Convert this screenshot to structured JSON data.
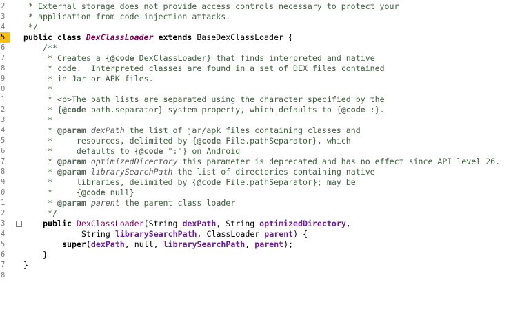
{
  "gutter": {
    "line_numbers": [
      "2",
      "3",
      "4",
      "5",
      "6",
      "7",
      "8",
      "9",
      "0",
      "1",
      "2",
      "3",
      "4",
      "5",
      "6",
      "7",
      "8",
      "9",
      "0",
      "1",
      "2",
      "3",
      "4",
      "5",
      "6",
      "7",
      "8"
    ],
    "current_line_index": 3,
    "fold_marker_glyph": "−"
  },
  "code": {
    "l0": "* External storage does not provide access controls necessary to protect your",
    "l1": "* application from code injection attacks.",
    "l2": "*/",
    "l3a": "public class ",
    "l3b": "DexClassLoader",
    "l3c": " extends ",
    "l3d": "BaseDexClassLoader {",
    "l4": "/**",
    "l5a": "* Creates a {",
    "l5b": "@code",
    "l5c": " DexClassLoader} that finds interpreted and native",
    "l6": "* code.  Interpreted classes are found in a set of DEX files contained",
    "l7": "* in Jar or APK files.",
    "l8": "*",
    "l9": "* <p>The path lists are separated using the character specified by the",
    "l10a": "* {",
    "l10b": "@code",
    "l10c": " path.separator} system property, which defaults to {",
    "l10d": "@code",
    "l10e": " :}.",
    "l11": "*",
    "l12a": "* ",
    "l12b": "@param",
    "l12c": " dexPath",
    "l12d": " the list of jar/apk files containing classes and",
    "l13a": "*     resources, delimited by {",
    "l13b": "@code",
    "l13c": " File.pathSeparator}, which",
    "l14a": "*     defaults to {",
    "l14b": "@code",
    "l14c": " \":\"} on Android",
    "l15a": "* ",
    "l15b": "@param",
    "l15c": " optimizedDirectory",
    "l15d": " this parameter is deprecated and has no effect since API level 26.",
    "l16a": "* ",
    "l16b": "@param",
    "l16c": " librarySearchPath",
    "l16d": " the list of directories containing native",
    "l17a": "*     libraries, delimited by {",
    "l17b": "@code",
    "l17c": " File.pathSeparator}; may be",
    "l18a": "*     {",
    "l18b": "@code",
    "l18c": " null}",
    "l19a": "* ",
    "l19b": "@param",
    "l19c": " parent",
    "l19d": " the parent class loader",
    "l20": "*/",
    "l21a": "public ",
    "l21b": "DexClassLoader",
    "l21c": "(String ",
    "l21d": "dexPath",
    "l21e": ", String ",
    "l21f": "optimizedDirectory",
    "l21g": ",",
    "l22a": "String ",
    "l22b": "librarySearchPath",
    "l22c": ", ClassLoader ",
    "l22d": "parent",
    "l22e": ") {",
    "l23a": "super",
    "l23b": "(",
    "l23c": "dexPath",
    "l23d": ", null, ",
    "l23e": "librarySearchPath",
    "l23f": ", ",
    "l23g": "parent",
    "l23h": ");",
    "l24": "}",
    "l25": "}"
  },
  "colors": {
    "current_line_marker": "#ffc000",
    "comment": "#3f5f3f",
    "class_name": "#7f0055",
    "parameter": "#6a1b9a"
  }
}
